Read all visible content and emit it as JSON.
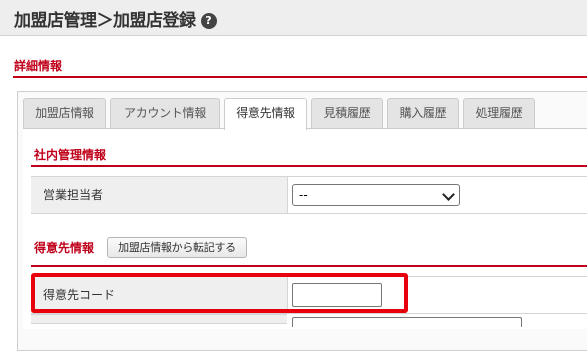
{
  "header": {
    "title": "加盟店管理＞加盟店登録",
    "help_icon": "?"
  },
  "section": {
    "title": "詳細情報"
  },
  "tabs": [
    {
      "label": "加盟店情報",
      "active": false
    },
    {
      "label": "アカウント情報",
      "active": false
    },
    {
      "label": "得意先情報",
      "active": true
    },
    {
      "label": "見積履歴",
      "active": false
    },
    {
      "label": "購入履歴",
      "active": false
    },
    {
      "label": "処理履歴",
      "active": false
    }
  ],
  "internal": {
    "title": "社内管理情報",
    "sales_rep_label": "営業担当者",
    "sales_rep_value": "--"
  },
  "customer": {
    "title": "得意先情報",
    "copy_button": "加盟店情報から転記する",
    "code_label": "得意先コード",
    "code_value": ""
  },
  "colors": {
    "accent": "#c0001a",
    "highlight": "#e8000d"
  }
}
